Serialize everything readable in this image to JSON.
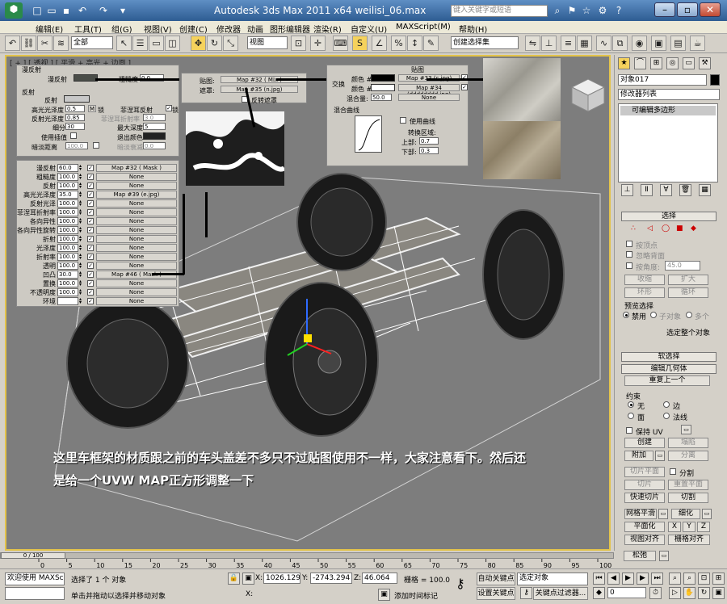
{
  "titlebar": {
    "title": "Autodesk 3ds Max  2011 x64        weilisi_06.max",
    "search_placeholder": "键入关键字或短语"
  },
  "menu": [
    "编辑(E)",
    "工具(T)",
    "组(G)",
    "视图(V)",
    "创建(C)",
    "修改器",
    "动画",
    "图形编辑器",
    "渲染(R)",
    "自定义(U)",
    "MAXScript(M)",
    "帮助(H)"
  ],
  "toolbar": {
    "filter": "全部",
    "view_ref": "视图",
    "selection_set": "创建选择集"
  },
  "viewport": {
    "label": "[ + ] [ 透视 ] [ 平滑 + 高光 + 边面 ]",
    "caption_line1": "这里车框架的材质跟之前的车头盖差不多只不过贴图使用不一样，大家注意看下。然后还",
    "caption_line2": "是给一个UVW MAP正方形调整一下"
  },
  "material": {
    "basic_header": "漫反射",
    "diffuse_label": "漫反射",
    "roughness_label": "粗糙度",
    "roughness_value": "0.0",
    "reflection_header": "反射",
    "reflect_label": "反射",
    "hilight_gloss_label": "高光光泽度",
    "hilight_gloss_value": "0.5",
    "lock_label": "锁",
    "refl_gloss_label": "反射光泽度",
    "refl_gloss_value": "0.85",
    "subdivs_label": "细分",
    "subdivs_value": "30",
    "interp_label": "使用插值",
    "dim_label": "暗淡距离",
    "dim_value": "100.0",
    "fresnel_label": "菲涅耳反射",
    "fresnel_ior_label": "菲涅耳折射率",
    "fresnel_ior_value": "3.0",
    "max_depth_label": "最大深度",
    "max_depth_value": "5",
    "exit_color_label": "退出颜色",
    "dim_falloff_label": "暗淡衰减",
    "dim_falloff_value": "0.0",
    "maps": [
      {
        "label": "漫反射",
        "value": "60.0",
        "checked": "✓",
        "map": "Map #32 ( Mask )"
      },
      {
        "label": "粗糙度",
        "value": "100.0",
        "checked": "✓",
        "map": "None"
      },
      {
        "label": "反射",
        "value": "100.0",
        "checked": "✓",
        "map": "None"
      },
      {
        "label": "高光光泽度",
        "value": "35.0",
        "checked": "✓",
        "map": "Map #39 (e.jpg)"
      },
      {
        "label": "反射光泽",
        "value": "100.0",
        "checked": "✓",
        "map": "None"
      },
      {
        "label": "菲涅耳折射率",
        "value": "100.0",
        "checked": "✓",
        "map": "None"
      },
      {
        "label": "各向异性",
        "value": "100.0",
        "checked": "✓",
        "map": "None"
      },
      {
        "label": "各向异性旋转",
        "value": "100.0",
        "checked": "✓",
        "map": "None"
      },
      {
        "label": "折射",
        "value": "100.0",
        "checked": "✓",
        "map": "None"
      },
      {
        "label": "光泽度",
        "value": "100.0",
        "checked": "✓",
        "map": "None"
      },
      {
        "label": "折射率",
        "value": "100.0",
        "checked": "✓",
        "map": "None"
      },
      {
        "label": "透明",
        "value": "100.0",
        "checked": "✓",
        "map": "None"
      },
      {
        "label": "凹凸",
        "value": "30.0",
        "checked": "✓",
        "map": "Map #46 ( Mask )"
      },
      {
        "label": "置换",
        "value": "100.0",
        "checked": "✓",
        "map": "None"
      },
      {
        "label": "不透明度",
        "value": "100.0",
        "checked": "✓",
        "map": "None"
      },
      {
        "label": "环境",
        "value": "",
        "checked": "✓",
        "map": "None"
      }
    ],
    "mask": {
      "map_label": "贴图:",
      "map_value": "Map #32 ( Mix )",
      "mask_label": "遮罩:",
      "mask_value": "Map #35 (n.jpg)",
      "invert_label": "反转遮罩"
    },
    "mix": {
      "header": "贴图",
      "swap_label": "交换",
      "color1_label": "颜色 #1",
      "color1_map": "Map #33 (c.jpg)",
      "color2_label": "颜色 #2",
      "color2_map": "Map #34 (dddddddd.jpg)",
      "amount_label": "混合量:",
      "amount_value": "50.0",
      "amount_map": "None",
      "curve_header": "混合曲线",
      "use_curve_label": "使用曲线",
      "zone_label": "转换区域:",
      "upper_label": "上部:",
      "upper_value": "0.7",
      "lower_label": "下部:",
      "lower_value": "0.3"
    }
  },
  "command_panel": {
    "object_name": "对象017",
    "modifier_list": "修改器列表",
    "stack_item": "可编辑多边形",
    "selection_header": "选择",
    "by_vertex": "按顶点",
    "ignore_back": "忽略背面",
    "by_angle": "按角度:",
    "angle_value": "45.0",
    "shrink": "收缩",
    "grow": "扩大",
    "ring": "环形",
    "loop": "循环",
    "preview_header": "预览选择",
    "disabled": "禁用",
    "subobject": "子对象",
    "multi": "多个",
    "selected_count": "选定整个对象",
    "soft_select": "软选择",
    "edit_geometry": "编辑几何体",
    "repeat_last": "重复上一个",
    "constraints": "约束",
    "c_none": "无",
    "c_edge": "边",
    "c_face": "面",
    "c_normal": "法线",
    "preserve_uv": "保持 UV",
    "create": "创建",
    "collapse": "塌陷",
    "attach": "附加",
    "detach": "分离",
    "slice_plane": "切片平面",
    "split": "分割",
    "slice": "切片",
    "reset_plane": "重置平面",
    "quickslice": "快速切片",
    "cut": "切割",
    "msmooth": "网格平滑",
    "tessellate": "细化",
    "make_planar": "平面化",
    "x": "X",
    "y": "Y",
    "z": "Z",
    "view_align": "视图对齐",
    "grid_align": "栅格对齐",
    "relax": "松弛"
  },
  "timeline": {
    "frame": "0 / 100",
    "ticks": [
      "0",
      "5",
      "10",
      "15",
      "20",
      "25",
      "30",
      "35",
      "40",
      "45",
      "50",
      "55",
      "60",
      "65",
      "70",
      "75",
      "80",
      "85",
      "90",
      "95",
      "100"
    ]
  },
  "status": {
    "welcome": "欢迎使用 MAXSc",
    "selected": "选择了 1 个 对象",
    "hint": "单击并拖动以选择并移动对象",
    "x_label": "X:",
    "x_value": "1026.129",
    "y_label": "Y:",
    "y_value": "-2743.294",
    "z_label": "Z:",
    "z_value": "46.064",
    "grid_label": "栅格 = 100.0",
    "add_tag": "添加时间标记",
    "auto_key": "自动关键点",
    "set_key": "设置关键点",
    "selected_obj": "选定对象",
    "key_filters": "关键点过滤器...",
    "frame_value": "0"
  }
}
